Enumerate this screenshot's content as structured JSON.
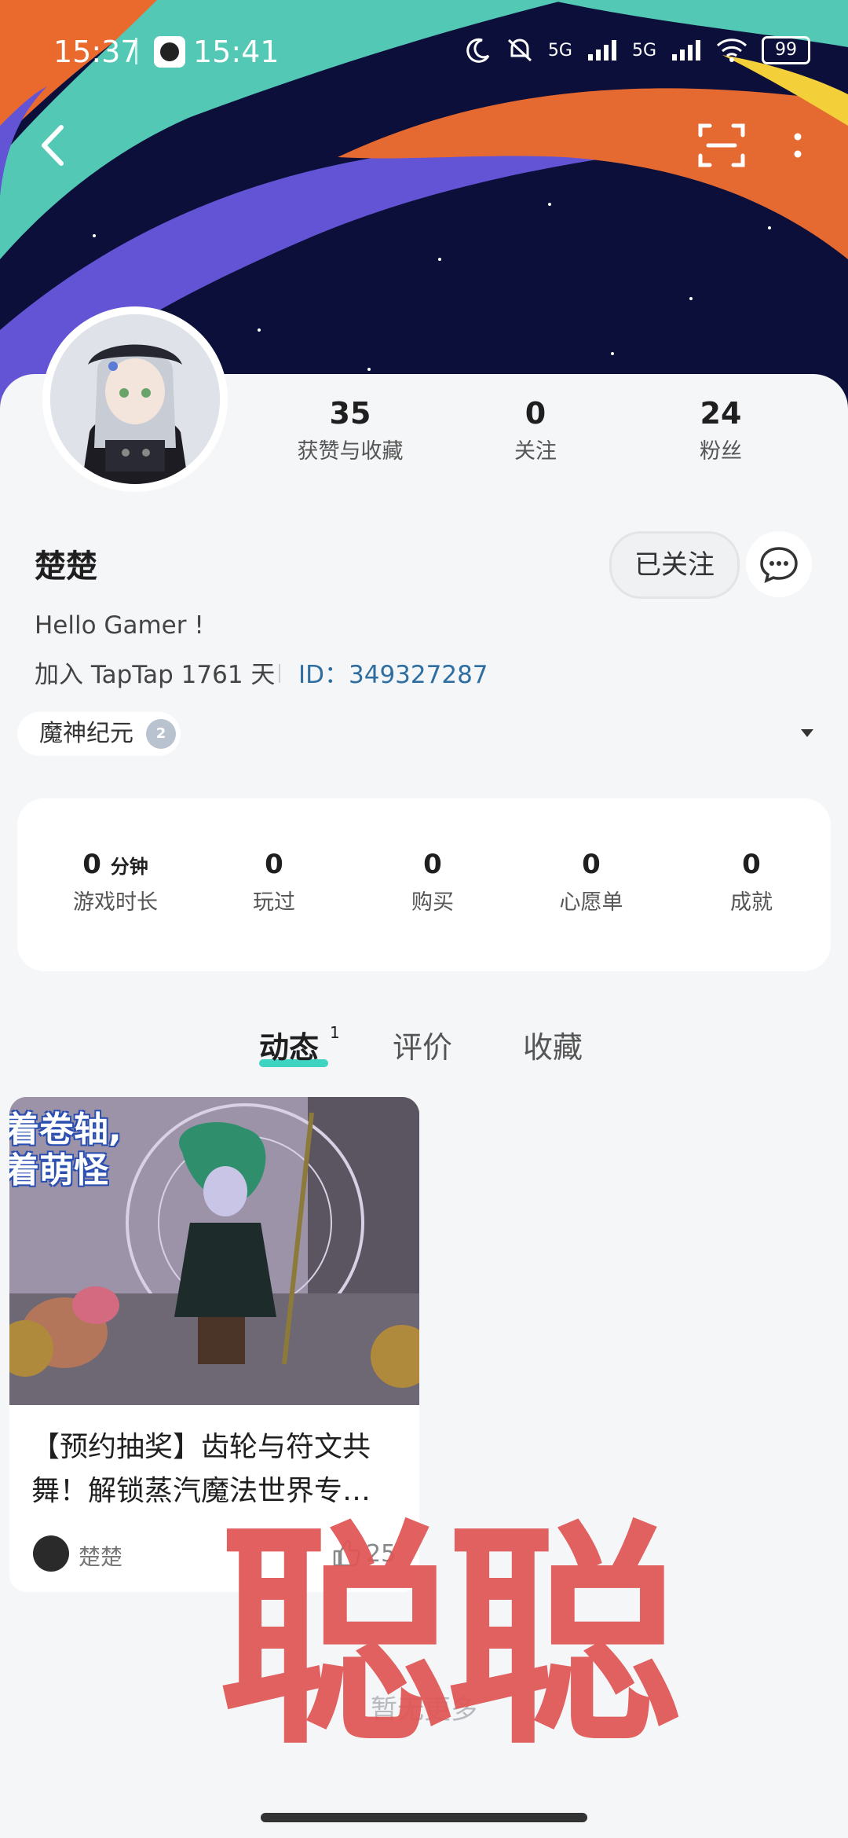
{
  "status_bar": {
    "time_1": "15:37",
    "time_2": "15:41",
    "net_1": "5G",
    "net_2": "5G",
    "battery": "99"
  },
  "profile": {
    "stats": [
      {
        "value": "35",
        "label": "获赞与收藏"
      },
      {
        "value": "0",
        "label": "关注"
      },
      {
        "value": "24",
        "label": "粉丝"
      }
    ],
    "username": "楚楚",
    "follow_label": "已关注",
    "bio": "Hello Gamer !",
    "joined": "加入 TapTap 1761 天",
    "id_text": "ID：349327287",
    "game_tag": "魔神纪元",
    "game_tag_level": "2"
  },
  "metrics": [
    {
      "value": "0",
      "unit": "分钟",
      "label": "游戏时长"
    },
    {
      "value": "0",
      "unit": "",
      "label": "玩过"
    },
    {
      "value": "0",
      "unit": "",
      "label": "购买"
    },
    {
      "value": "0",
      "unit": "",
      "label": "心愿单"
    },
    {
      "value": "0",
      "unit": "",
      "label": "成就"
    }
  ],
  "tabs": [
    {
      "label": "动态",
      "count": "1",
      "active": true
    },
    {
      "label": "评价"
    },
    {
      "label": "收藏"
    }
  ],
  "post": {
    "image_text": "着卷轴,着萌怪",
    "title": "【预约抽奖】齿轮与符文共舞！解锁蒸汽魔法世界专…",
    "author": "楚楚",
    "likes": "25"
  },
  "no_more": "暂无更多",
  "watermark": "聪聪",
  "colors": {
    "accent": "#3fd3c1",
    "id_link": "#2f6ea0",
    "watermark": "#e05555"
  }
}
